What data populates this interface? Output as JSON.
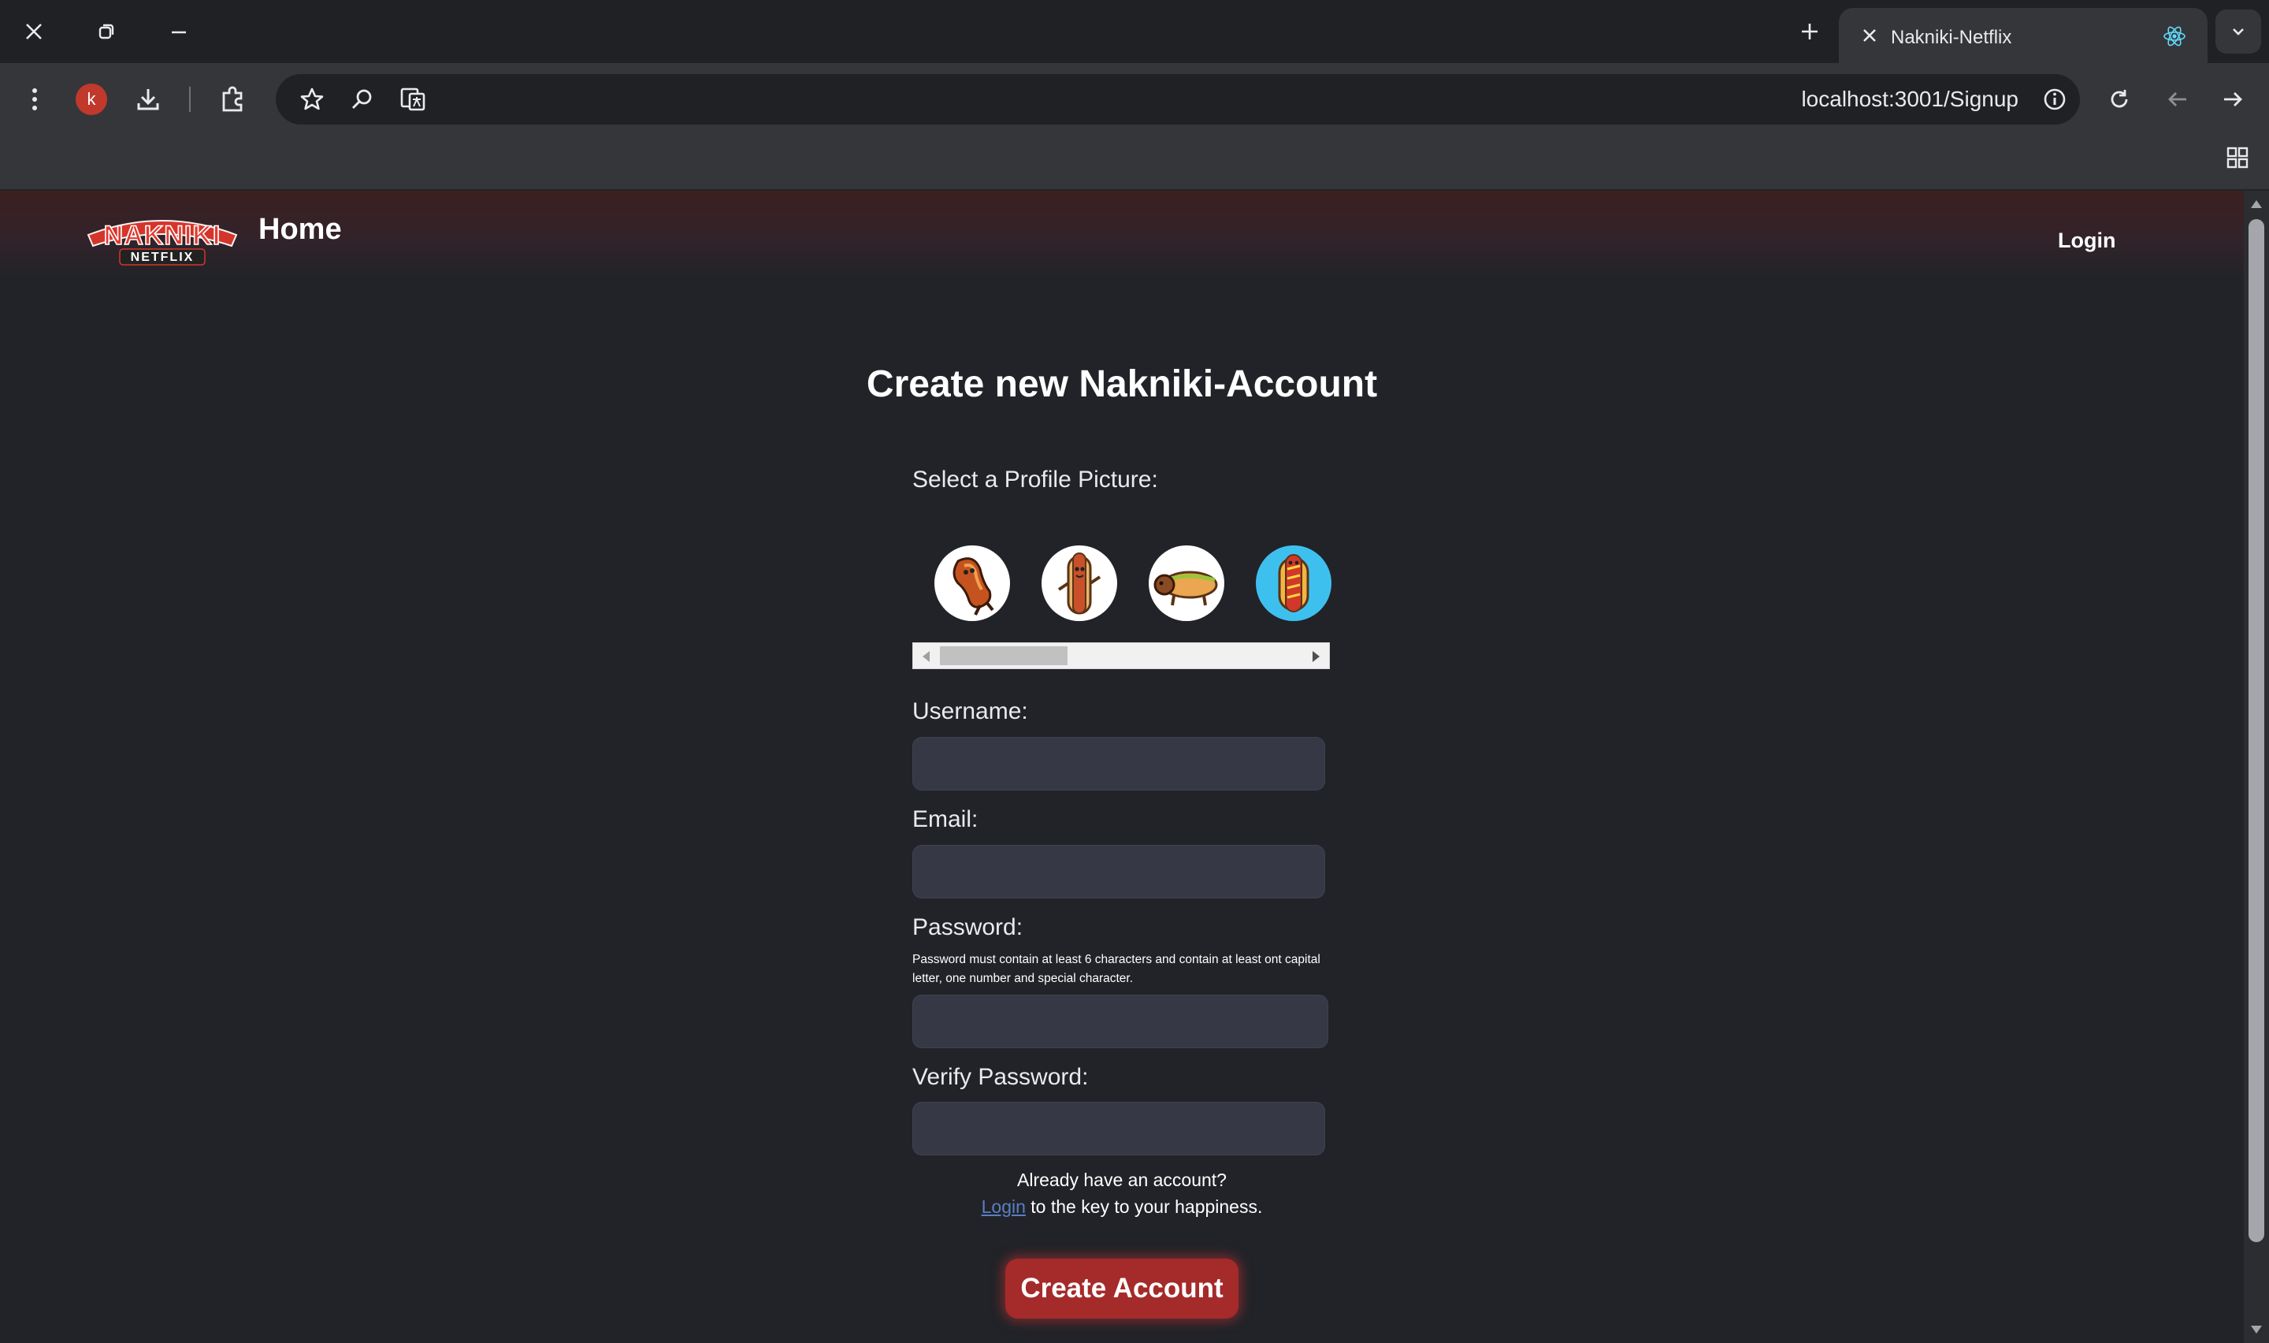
{
  "browser": {
    "tab_title": "Nakniki-Netflix",
    "profile_initial": "k",
    "url": "localhost:3001/Signup"
  },
  "nav": {
    "logo_top": "NAKNIKI",
    "logo_bottom": "NETFLIX",
    "home_label": "Home",
    "login_label": "Login"
  },
  "form": {
    "title": "Create new Nakniki-Account",
    "profile_picture_label": "Select a Profile Picture:",
    "profile_pictures": [
      {
        "name": "hotdog-dancing",
        "bg": "#ffffff"
      },
      {
        "name": "hotdog-standing",
        "bg": "#ffffff"
      },
      {
        "name": "hotdog-dog",
        "bg": "#ffffff"
      },
      {
        "name": "hotdog-mustard",
        "bg": "#3ec0ef"
      }
    ],
    "username_label": "Username:",
    "username_value": "",
    "email_label": "Email:",
    "email_value": "",
    "password_label": "Password:",
    "password_hint": "Password must contain at least 6 characters and contain at least ont capital letter, one number and special character.",
    "password_value": "",
    "verify_label": "Verify Password:",
    "verify_value": "",
    "already_text": "Already have an account?",
    "login_link": "Login",
    "login_suffix": "to the key to your happiness.",
    "submit_label": "Create Account"
  },
  "colors": {
    "page_bg": "#212328",
    "accent": "#a52a2a",
    "link": "#5b7fc4",
    "input_bg": "#363945"
  }
}
